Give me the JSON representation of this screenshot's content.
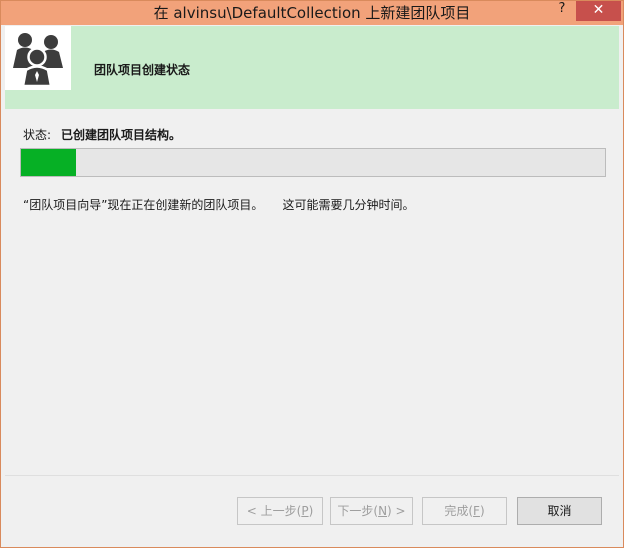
{
  "window": {
    "title": "在 alvinsu\\DefaultCollection 上新建团队项目",
    "help_label": "?",
    "close_label": "✕"
  },
  "header": {
    "title": "团队项目创建状态",
    "icon": "team-users-icon"
  },
  "status": {
    "label": "状态:",
    "value": "已创建团队项目结构。"
  },
  "progress": {
    "fraction": 0.095,
    "color": "#06b025"
  },
  "message": "“团队项目向导”现在正在创建新的团队项目。     这可能需要几分钟时间。",
  "buttons": {
    "prev": {
      "prefix": "< 上一步(",
      "key": "P",
      "suffix": ")"
    },
    "next": {
      "prefix": "下一步(",
      "key": "N",
      "suffix": ") >"
    },
    "finish": {
      "prefix": "完成(",
      "key": "F",
      "suffix": ")"
    },
    "cancel": "取消"
  },
  "colors": {
    "titlebar": "#f2a27a",
    "header_bg": "#c9eccd",
    "close_button": "#c7504c"
  }
}
